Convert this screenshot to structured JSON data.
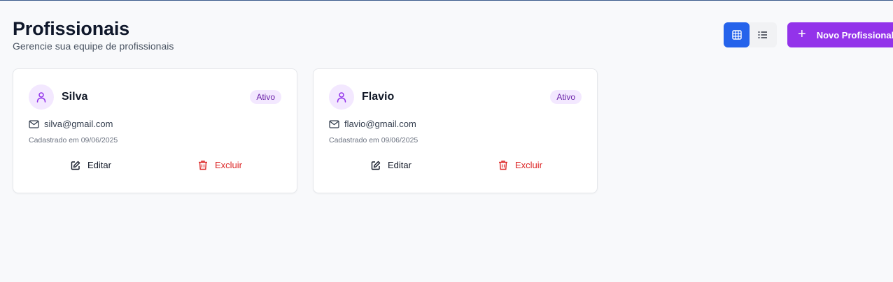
{
  "header": {
    "title": "Profissionais",
    "subtitle": "Gerencie sua equipe de profissionais"
  },
  "toolbar": {
    "grid_view_icon": "grid-icon",
    "list_view_icon": "list-icon",
    "active_view": "grid",
    "new_button_label": "Novo Profissional",
    "new_button_icon": "plus-icon"
  },
  "colors": {
    "primary_blue": "#2563eb",
    "primary_purple": "#9333ea",
    "badge_bg": "#f3e8ff",
    "danger": "#dc2626"
  },
  "professionals": [
    {
      "name": "Silva",
      "status": "Ativo",
      "email": "silva@gmail.com",
      "registered": "Cadastrado em 09/06/2025",
      "edit_label": "Editar",
      "delete_label": "Excluir"
    },
    {
      "name": "Flavio",
      "status": "Ativo",
      "email": "flavio@gmail.com",
      "registered": "Cadastrado em 09/06/2025",
      "edit_label": "Editar",
      "delete_label": "Excluir"
    }
  ]
}
